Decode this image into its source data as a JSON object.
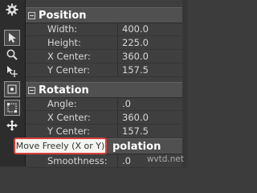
{
  "position": {
    "title": "Position",
    "rows": [
      {
        "label": "Width:",
        "value": "400.0"
      },
      {
        "label": "Height:",
        "value": "225.0"
      },
      {
        "label": "X Center:",
        "value": "360.0"
      },
      {
        "label": "Y Center:",
        "value": "157.5"
      }
    ]
  },
  "rotation": {
    "title": "Rotation",
    "rows": [
      {
        "label": "Angle:",
        "value": ".0"
      },
      {
        "label": "X Center:",
        "value": "360.0"
      },
      {
        "label": "Y Center:",
        "value": "157.5"
      }
    ]
  },
  "interpolation": {
    "title_fragment": "polation",
    "rows": [
      {
        "label": "Smoothness:",
        "value": ".0"
      }
    ]
  },
  "tooltip": {
    "text": "Move Freely (X or Y)"
  },
  "watermark": {
    "text": "wvtd.net"
  },
  "toolbar": {
    "icons": [
      "gear-icon",
      "arrow-pointer-icon",
      "magnifier-icon",
      "move-anchor-icon",
      "enable-rotation-icon",
      "enable-sizing-icon",
      "move-freely-icon"
    ]
  }
}
